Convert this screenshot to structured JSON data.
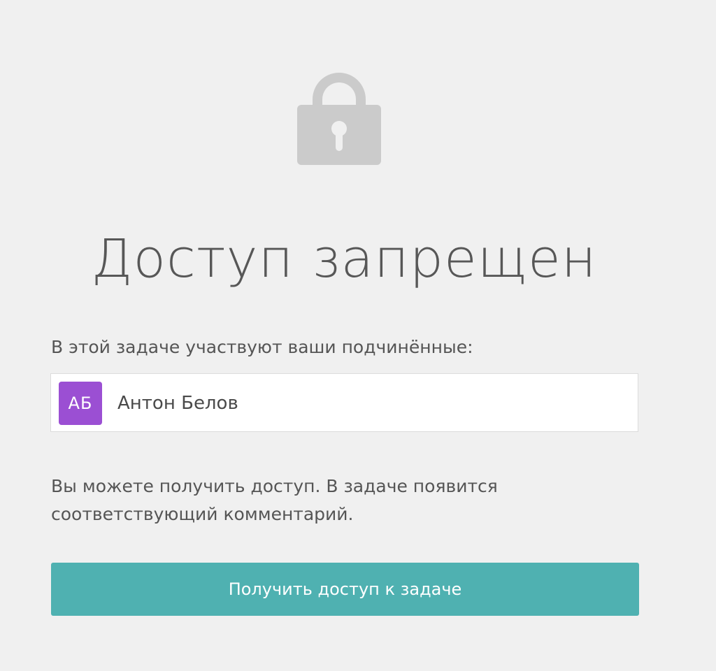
{
  "colors": {
    "background": "#f0f0f0",
    "lock_icon": "#cbcbcb",
    "avatar_bg": "#9b4fd3",
    "button_bg": "#4fb1b1",
    "button_text": "#ffffff"
  },
  "lock": {
    "icon": "lock-icon"
  },
  "title": "Доступ запрещен",
  "subordinates": {
    "label": "В этой задаче участвуют ваши подчинённые:",
    "users": [
      {
        "initials": "АБ",
        "name": "Антон Белов"
      }
    ]
  },
  "info": {
    "line1": "Вы можете получить доступ. В задаче появится",
    "line2": "соответствующий комментарий."
  },
  "button": {
    "label": "Получить доступ к задаче"
  }
}
